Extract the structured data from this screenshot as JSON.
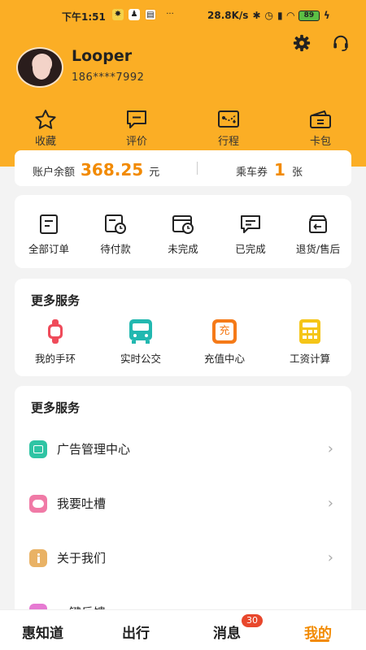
{
  "status_bar": {
    "time": "下午1:51",
    "network_speed": "28.8K/s",
    "battery": "89"
  },
  "header": {
    "username": "Looper",
    "phone": "186****7992",
    "icons": [
      "gear-icon",
      "headset-icon"
    ]
  },
  "quick_actions": [
    {
      "label": "收藏",
      "icon": "star-icon"
    },
    {
      "label": "评价",
      "icon": "comment-icon"
    },
    {
      "label": "行程",
      "icon": "route-map-icon"
    },
    {
      "label": "卡包",
      "icon": "wallet-icon"
    }
  ],
  "balance": {
    "label": "账户余额",
    "amount": "368.25",
    "unit": "元",
    "ticket_label": "乘车券",
    "ticket_count": "1",
    "ticket_unit": "张"
  },
  "orders": [
    {
      "label": "全部订单",
      "icon": "order-list-icon"
    },
    {
      "label": "待付款",
      "icon": "pending-payment-icon"
    },
    {
      "label": "未完成",
      "icon": "incomplete-icon"
    },
    {
      "label": "已完成",
      "icon": "completed-icon"
    },
    {
      "label": "退货/售后",
      "icon": "return-icon"
    }
  ],
  "services": {
    "title": "更多服务",
    "items": [
      {
        "label": "我的手环",
        "icon": "wristband-icon",
        "color": "#ef4b5a"
      },
      {
        "label": "实时公交",
        "icon": "bus-icon",
        "color": "#22b8b0"
      },
      {
        "label": "充值中心",
        "icon": "recharge-icon",
        "color": "#f57a18",
        "glyph": "充"
      },
      {
        "label": "工资计算",
        "icon": "calculator-icon",
        "color": "#f5c518"
      }
    ]
  },
  "more_services": {
    "title": "更多服务",
    "items": [
      {
        "label": "广告管理中心",
        "icon": "ad-manage-icon",
        "color": "#2fc4a4"
      },
      {
        "label": "我要吐槽",
        "icon": "chat-bubble-icon",
        "color": "#f07aa6"
      },
      {
        "label": "关于我们",
        "icon": "info-icon",
        "color": "#e9b265"
      },
      {
        "label": "一键反馈",
        "icon": "feedback-icon",
        "color": "#e67ad2"
      }
    ],
    "arrow": "›"
  },
  "tabbar": {
    "tabs": [
      {
        "label": "惠知道"
      },
      {
        "label": "出行"
      },
      {
        "label": "消息"
      },
      {
        "label": "我的"
      }
    ],
    "message_badge": "30",
    "active_color": "#f28a00"
  }
}
